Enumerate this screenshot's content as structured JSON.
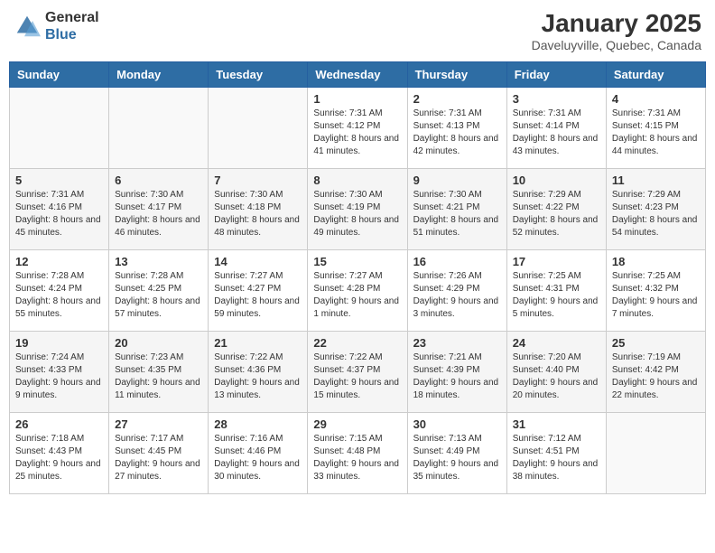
{
  "header": {
    "logo_general": "General",
    "logo_blue": "Blue",
    "month_title": "January 2025",
    "location": "Daveluyville, Quebec, Canada"
  },
  "weekdays": [
    "Sunday",
    "Monday",
    "Tuesday",
    "Wednesday",
    "Thursday",
    "Friday",
    "Saturday"
  ],
  "weeks": [
    [
      {
        "day": "",
        "sunrise": "",
        "sunset": "",
        "daylight": ""
      },
      {
        "day": "",
        "sunrise": "",
        "sunset": "",
        "daylight": ""
      },
      {
        "day": "",
        "sunrise": "",
        "sunset": "",
        "daylight": ""
      },
      {
        "day": "1",
        "sunrise": "Sunrise: 7:31 AM",
        "sunset": "Sunset: 4:12 PM",
        "daylight": "Daylight: 8 hours and 41 minutes."
      },
      {
        "day": "2",
        "sunrise": "Sunrise: 7:31 AM",
        "sunset": "Sunset: 4:13 PM",
        "daylight": "Daylight: 8 hours and 42 minutes."
      },
      {
        "day": "3",
        "sunrise": "Sunrise: 7:31 AM",
        "sunset": "Sunset: 4:14 PM",
        "daylight": "Daylight: 8 hours and 43 minutes."
      },
      {
        "day": "4",
        "sunrise": "Sunrise: 7:31 AM",
        "sunset": "Sunset: 4:15 PM",
        "daylight": "Daylight: 8 hours and 44 minutes."
      }
    ],
    [
      {
        "day": "5",
        "sunrise": "Sunrise: 7:31 AM",
        "sunset": "Sunset: 4:16 PM",
        "daylight": "Daylight: 8 hours and 45 minutes."
      },
      {
        "day": "6",
        "sunrise": "Sunrise: 7:30 AM",
        "sunset": "Sunset: 4:17 PM",
        "daylight": "Daylight: 8 hours and 46 minutes."
      },
      {
        "day": "7",
        "sunrise": "Sunrise: 7:30 AM",
        "sunset": "Sunset: 4:18 PM",
        "daylight": "Daylight: 8 hours and 48 minutes."
      },
      {
        "day": "8",
        "sunrise": "Sunrise: 7:30 AM",
        "sunset": "Sunset: 4:19 PM",
        "daylight": "Daylight: 8 hours and 49 minutes."
      },
      {
        "day": "9",
        "sunrise": "Sunrise: 7:30 AM",
        "sunset": "Sunset: 4:21 PM",
        "daylight": "Daylight: 8 hours and 51 minutes."
      },
      {
        "day": "10",
        "sunrise": "Sunrise: 7:29 AM",
        "sunset": "Sunset: 4:22 PM",
        "daylight": "Daylight: 8 hours and 52 minutes."
      },
      {
        "day": "11",
        "sunrise": "Sunrise: 7:29 AM",
        "sunset": "Sunset: 4:23 PM",
        "daylight": "Daylight: 8 hours and 54 minutes."
      }
    ],
    [
      {
        "day": "12",
        "sunrise": "Sunrise: 7:28 AM",
        "sunset": "Sunset: 4:24 PM",
        "daylight": "Daylight: 8 hours and 55 minutes."
      },
      {
        "day": "13",
        "sunrise": "Sunrise: 7:28 AM",
        "sunset": "Sunset: 4:25 PM",
        "daylight": "Daylight: 8 hours and 57 minutes."
      },
      {
        "day": "14",
        "sunrise": "Sunrise: 7:27 AM",
        "sunset": "Sunset: 4:27 PM",
        "daylight": "Daylight: 8 hours and 59 minutes."
      },
      {
        "day": "15",
        "sunrise": "Sunrise: 7:27 AM",
        "sunset": "Sunset: 4:28 PM",
        "daylight": "Daylight: 9 hours and 1 minute."
      },
      {
        "day": "16",
        "sunrise": "Sunrise: 7:26 AM",
        "sunset": "Sunset: 4:29 PM",
        "daylight": "Daylight: 9 hours and 3 minutes."
      },
      {
        "day": "17",
        "sunrise": "Sunrise: 7:25 AM",
        "sunset": "Sunset: 4:31 PM",
        "daylight": "Daylight: 9 hours and 5 minutes."
      },
      {
        "day": "18",
        "sunrise": "Sunrise: 7:25 AM",
        "sunset": "Sunset: 4:32 PM",
        "daylight": "Daylight: 9 hours and 7 minutes."
      }
    ],
    [
      {
        "day": "19",
        "sunrise": "Sunrise: 7:24 AM",
        "sunset": "Sunset: 4:33 PM",
        "daylight": "Daylight: 9 hours and 9 minutes."
      },
      {
        "day": "20",
        "sunrise": "Sunrise: 7:23 AM",
        "sunset": "Sunset: 4:35 PM",
        "daylight": "Daylight: 9 hours and 11 minutes."
      },
      {
        "day": "21",
        "sunrise": "Sunrise: 7:22 AM",
        "sunset": "Sunset: 4:36 PM",
        "daylight": "Daylight: 9 hours and 13 minutes."
      },
      {
        "day": "22",
        "sunrise": "Sunrise: 7:22 AM",
        "sunset": "Sunset: 4:37 PM",
        "daylight": "Daylight: 9 hours and 15 minutes."
      },
      {
        "day": "23",
        "sunrise": "Sunrise: 7:21 AM",
        "sunset": "Sunset: 4:39 PM",
        "daylight": "Daylight: 9 hours and 18 minutes."
      },
      {
        "day": "24",
        "sunrise": "Sunrise: 7:20 AM",
        "sunset": "Sunset: 4:40 PM",
        "daylight": "Daylight: 9 hours and 20 minutes."
      },
      {
        "day": "25",
        "sunrise": "Sunrise: 7:19 AM",
        "sunset": "Sunset: 4:42 PM",
        "daylight": "Daylight: 9 hours and 22 minutes."
      }
    ],
    [
      {
        "day": "26",
        "sunrise": "Sunrise: 7:18 AM",
        "sunset": "Sunset: 4:43 PM",
        "daylight": "Daylight: 9 hours and 25 minutes."
      },
      {
        "day": "27",
        "sunrise": "Sunrise: 7:17 AM",
        "sunset": "Sunset: 4:45 PM",
        "daylight": "Daylight: 9 hours and 27 minutes."
      },
      {
        "day": "28",
        "sunrise": "Sunrise: 7:16 AM",
        "sunset": "Sunset: 4:46 PM",
        "daylight": "Daylight: 9 hours and 30 minutes."
      },
      {
        "day": "29",
        "sunrise": "Sunrise: 7:15 AM",
        "sunset": "Sunset: 4:48 PM",
        "daylight": "Daylight: 9 hours and 33 minutes."
      },
      {
        "day": "30",
        "sunrise": "Sunrise: 7:13 AM",
        "sunset": "Sunset: 4:49 PM",
        "daylight": "Daylight: 9 hours and 35 minutes."
      },
      {
        "day": "31",
        "sunrise": "Sunrise: 7:12 AM",
        "sunset": "Sunset: 4:51 PM",
        "daylight": "Daylight: 9 hours and 38 minutes."
      },
      {
        "day": "",
        "sunrise": "",
        "sunset": "",
        "daylight": ""
      }
    ]
  ]
}
